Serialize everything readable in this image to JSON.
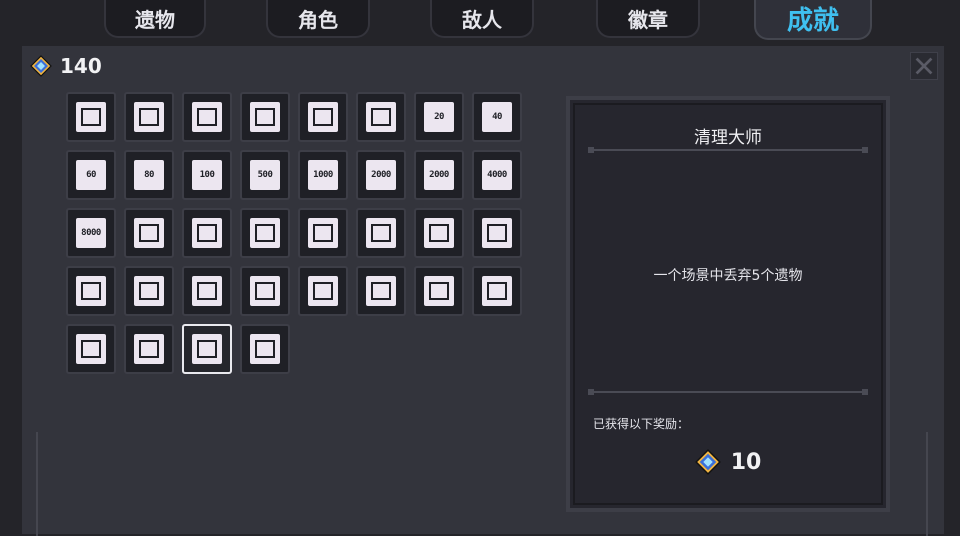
{
  "tabs": [
    {
      "label": "遗物",
      "active": false
    },
    {
      "label": "角色",
      "active": false
    },
    {
      "label": "敌人",
      "active": false
    },
    {
      "label": "徽章",
      "active": false
    },
    {
      "label": "成就",
      "active": true
    }
  ],
  "currency": {
    "icon": "gem-icon",
    "amount": "140"
  },
  "achievements": [
    {
      "icon": "tombstone-icon",
      "text": ""
    },
    {
      "icon": "map-icon",
      "text": ""
    },
    {
      "icon": "map-icon",
      "text": ""
    },
    {
      "icon": "map-icon",
      "text": ""
    },
    {
      "icon": "map-icon",
      "text": ""
    },
    {
      "icon": "map-path-icon",
      "text": ""
    },
    {
      "icon": "banner-icon",
      "text": "20"
    },
    {
      "icon": "banner-icon",
      "text": "40"
    },
    {
      "icon": "banner-icon",
      "text": "60"
    },
    {
      "icon": "banner-icon",
      "text": "80"
    },
    {
      "icon": "banner-icon",
      "text": "100"
    },
    {
      "icon": "wall-icon",
      "text": "500"
    },
    {
      "icon": "wall-icon",
      "text": "1000"
    },
    {
      "icon": "wall-icon",
      "text": "2000"
    },
    {
      "icon": "brick-icon",
      "text": "2000"
    },
    {
      "icon": "brick-icon",
      "text": "4000"
    },
    {
      "icon": "brick-icon",
      "text": "8000"
    },
    {
      "icon": "heart-stand-icon",
      "text": ""
    },
    {
      "icon": "grid-icon",
      "text": ""
    },
    {
      "icon": "cat-face-icon",
      "text": ""
    },
    {
      "icon": "girl-face-icon",
      "text": ""
    },
    {
      "icon": "bunny-face-icon",
      "text": ""
    },
    {
      "icon": "headphone-face-icon",
      "text": ""
    },
    {
      "icon": "robot-face-icon",
      "text": ""
    },
    {
      "icon": "long-hair-face-icon",
      "text": ""
    },
    {
      "icon": "lantern-icon",
      "text": ""
    },
    {
      "icon": "hat-glasses-icon",
      "text": ""
    },
    {
      "icon": "sparkle-heart-icon",
      "text": ""
    },
    {
      "icon": "ghost-icon",
      "text": ""
    },
    {
      "icon": "flag-icon",
      "text": ""
    },
    {
      "icon": "music-note-icon",
      "text": ""
    },
    {
      "icon": "nodes-icon",
      "text": ""
    },
    {
      "icon": "balloons-icon",
      "text": ""
    },
    {
      "icon": "coins-icon",
      "text": ""
    },
    {
      "icon": "trash-bin-icon",
      "text": ""
    },
    {
      "icon": "castle-icon",
      "text": ""
    }
  ],
  "selected_index": 34,
  "detail": {
    "title": "清理大师",
    "description": "一个场景中丢弃5个遗物",
    "reward_label": "已获得以下奖励：",
    "reward_icon": "gem-icon",
    "reward_amount": "10"
  },
  "colors": {
    "accent": "#3fc0f0",
    "panel": "#33343c",
    "background": "#242429"
  }
}
